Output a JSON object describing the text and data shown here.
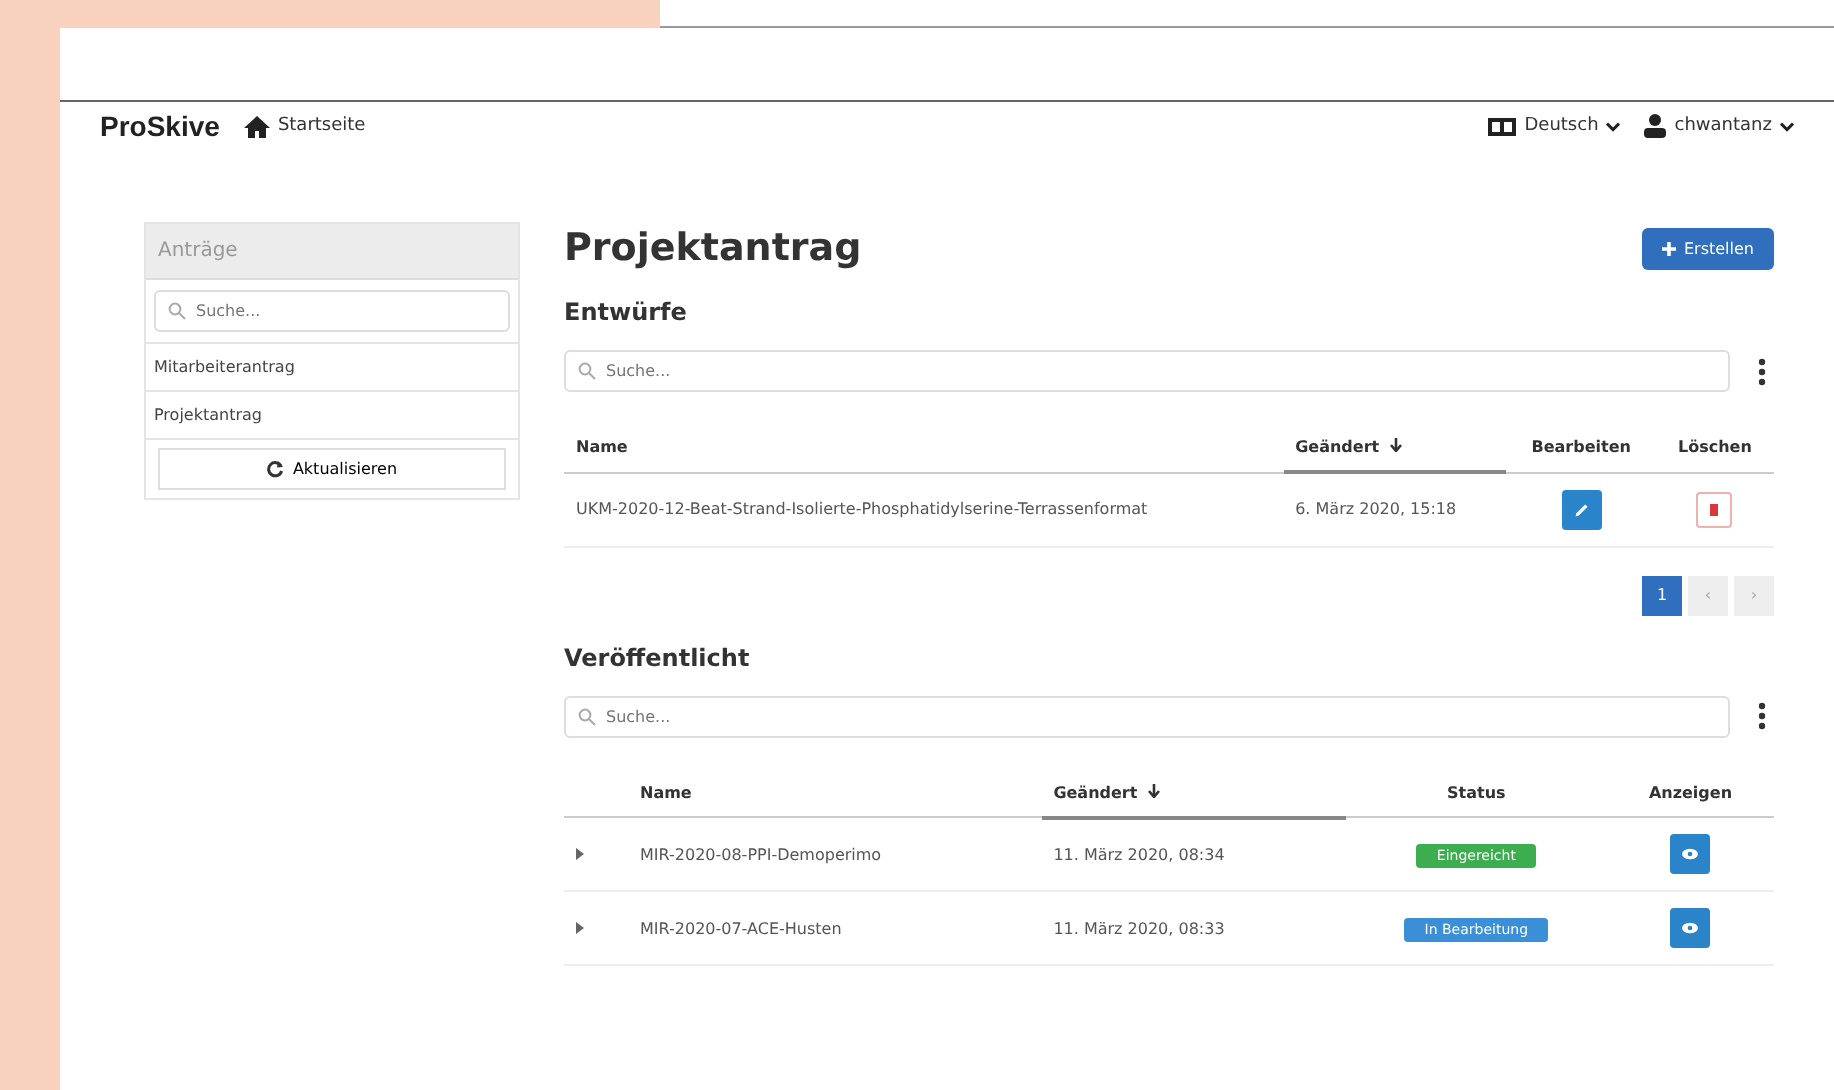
{
  "navbar": {
    "brand": "ProSkive",
    "home": "Startseite",
    "language": "Deutsch",
    "user": "chwantanz"
  },
  "sidebar": {
    "title": "Anträge",
    "search": {
      "placeholder": "Suche..."
    },
    "items": [
      {
        "label": "Mitarbeiterantrag",
        "selected": false
      },
      {
        "label": "Projektantrag",
        "selected": false
      }
    ],
    "refresh": "Aktualisieren"
  },
  "page": {
    "title": "Projektantrag",
    "create_button": "Erstellen"
  },
  "drafts": {
    "title": "Entwürfe",
    "search": {
      "placeholder": "Suche..."
    },
    "columns": [
      "Name",
      "Geändert",
      "Bearbeiten",
      "Löschen"
    ],
    "rows": [
      {
        "name": "UKM-2020-12-Beat-Strand-Isolierte-Phosphatidylserine-Terrassenformat",
        "changed": "6. März 2020, 15:18"
      }
    ],
    "pagination": [
      {
        "label": "1",
        "selected": true
      },
      {
        "label": "‹",
        "selected": false
      },
      {
        "label": "›",
        "selected": false
      }
    ]
  },
  "published": {
    "title": "Veröffentlicht",
    "search": {
      "placeholder": "Suche..."
    },
    "columns": [
      "Name",
      "Geändert",
      "Status",
      "Anzeigen"
    ],
    "rows": [
      {
        "name": "MIR-2020-08-PPI-Demoperimo",
        "changed": "11. März 2020, 08:34",
        "status": "Eingereicht",
        "color": "#3cae4f"
      },
      {
        "name": "MIR-2020-07-ACE-Husten",
        "changed": "11. März 2020, 08:33",
        "status": "In Bearbeitung",
        "color": "#3a8fd6"
      }
    ]
  }
}
